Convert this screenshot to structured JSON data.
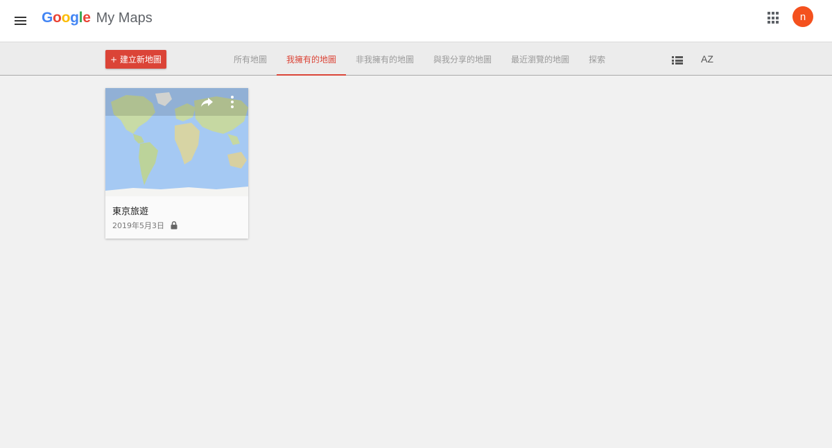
{
  "header": {
    "logo_product": "My Maps",
    "logo_google_letters": [
      "G",
      "o",
      "o",
      "g",
      "l",
      "e"
    ],
    "user_initial": "n",
    "avatar_color": "#f4511e"
  },
  "toolbar": {
    "create_button_label": "+ 建立新地圖",
    "tabs": [
      {
        "label": "所有地圖",
        "active": false
      },
      {
        "label": "我擁有的地圖",
        "active": true
      },
      {
        "label": "非我擁有的地圖",
        "active": false
      },
      {
        "label": "與我分享的地圖",
        "active": false
      },
      {
        "label": "最近瀏覽的地圖",
        "active": false
      },
      {
        "label": "探索",
        "active": false
      }
    ],
    "sort_label": "AZ",
    "accent_color": "#db4437"
  },
  "maps": [
    {
      "title": "東京旅遊",
      "date": "2019年5月3日",
      "private": true
    }
  ],
  "icons": [
    "menu-icon",
    "apps-grid-icon",
    "list-view-icon",
    "sort-az-icon",
    "share-icon",
    "more-vert-icon",
    "lock-icon"
  ]
}
